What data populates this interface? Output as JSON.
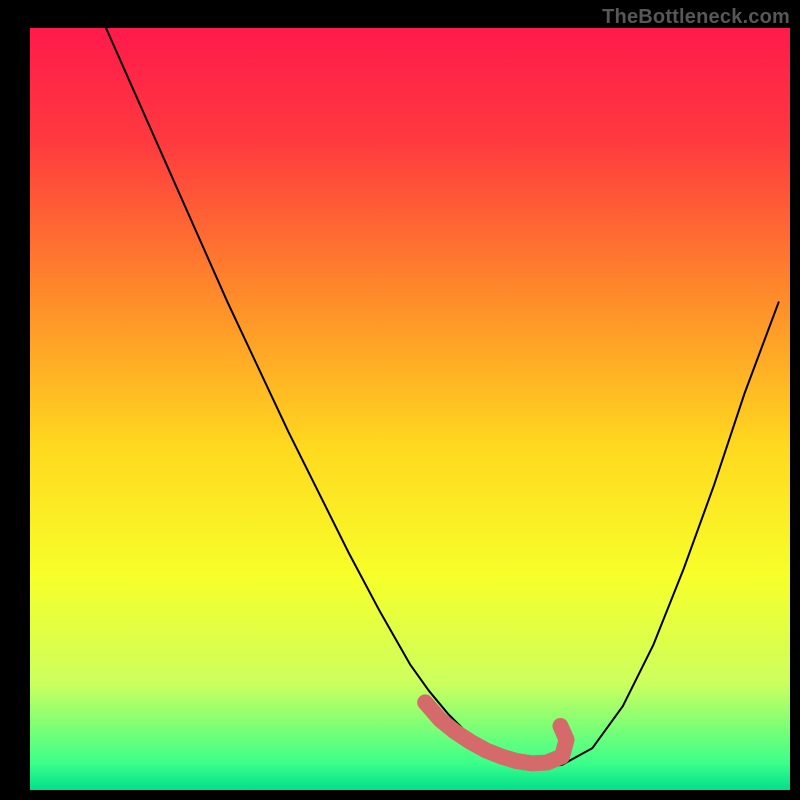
{
  "watermark": "TheBottleneck.com",
  "chart_data": {
    "type": "line",
    "title": "",
    "xlabel": "",
    "ylabel": "",
    "xlim": [
      0,
      100
    ],
    "ylim": [
      0,
      100
    ],
    "background_gradient": {
      "stops": [
        {
          "offset": 0.0,
          "color": "#ff1a4b"
        },
        {
          "offset": 0.15,
          "color": "#ff3a3f"
        },
        {
          "offset": 0.35,
          "color": "#ff8a2a"
        },
        {
          "offset": 0.55,
          "color": "#ffd91f"
        },
        {
          "offset": 0.72,
          "color": "#f7ff2a"
        },
        {
          "offset": 0.86,
          "color": "#ccff5e"
        },
        {
          "offset": 0.965,
          "color": "#3bff8a"
        },
        {
          "offset": 1.0,
          "color": "#00e08a"
        }
      ]
    },
    "series": [
      {
        "name": "curve",
        "type": "line",
        "color": "#000000",
        "x": [
          10.0,
          14,
          18,
          22,
          26,
          30,
          34,
          38,
          42,
          46,
          50,
          52.5,
          55,
          57.5,
          60,
          62.5,
          65,
          67.5,
          70,
          74,
          78,
          82,
          86,
          90,
          94,
          98.5
        ],
        "values": [
          100.0,
          91,
          82,
          73,
          64,
          55.5,
          47,
          39,
          31,
          23.5,
          16.5,
          13,
          10,
          7.5,
          5.5,
          4.2,
          3.4,
          3.0,
          3.3,
          5.5,
          11,
          19,
          29,
          40,
          52,
          64
        ]
      },
      {
        "name": "bottom-bead",
        "type": "thick-path",
        "color": "#d46a6a",
        "x": [
          52,
          54,
          56,
          58,
          60,
          62,
          64,
          66,
          68,
          70,
          70.6,
          69.8
        ],
        "values": [
          11.5,
          9.2,
          7.6,
          6.3,
          5.2,
          4.4,
          3.8,
          3.5,
          3.6,
          4.4,
          6.6,
          8.4
        ]
      }
    ]
  }
}
